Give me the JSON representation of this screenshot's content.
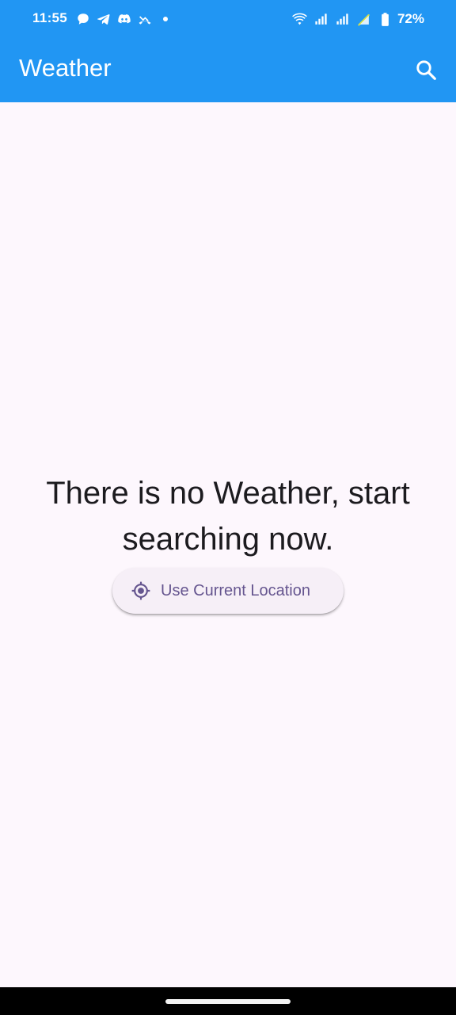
{
  "status_bar": {
    "time": "11:55",
    "left_icons": [
      "chat-bubble-icon",
      "telegram-icon",
      "discord-icon",
      "missed-call-icon",
      "dot-icon"
    ],
    "right_icons": [
      "wifi-icon",
      "signal-icon",
      "signal-icon",
      "data-saver-icon",
      "battery-icon"
    ],
    "battery": "72%"
  },
  "app_bar": {
    "title": "Weather",
    "action_icon": "search-icon",
    "color": "#2196f3"
  },
  "main": {
    "empty_message": "There is no Weather, start searching now.",
    "location_button": {
      "icon": "my-location-icon",
      "label": "Use Current Location",
      "color": "#65558f"
    }
  },
  "colors": {
    "background": "#fdf7fd",
    "text": "#1c1b1f",
    "button_background": "#f6eff7"
  }
}
